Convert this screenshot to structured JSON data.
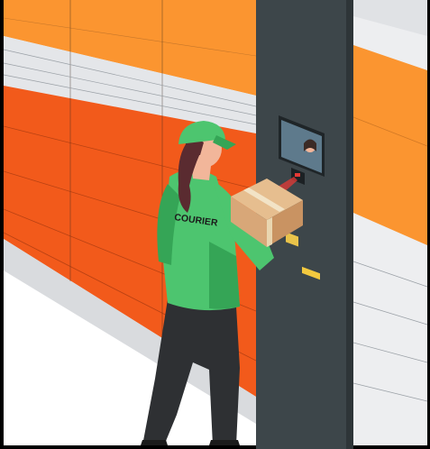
{
  "scene": {
    "vest_text": "COURIER",
    "colors": {
      "orange_light": "#FB9530",
      "orange_dark": "#F25A1B",
      "locker_white": "#EDEEF0",
      "panel": "#3D464A",
      "uniform": "#4DC56F",
      "uniform_shadow": "#35A556",
      "pants": "#2E3033",
      "hair": "#5A2B30",
      "skin": "#F2B69A",
      "box": "#D8A778",
      "laser": "#E53935"
    }
  }
}
